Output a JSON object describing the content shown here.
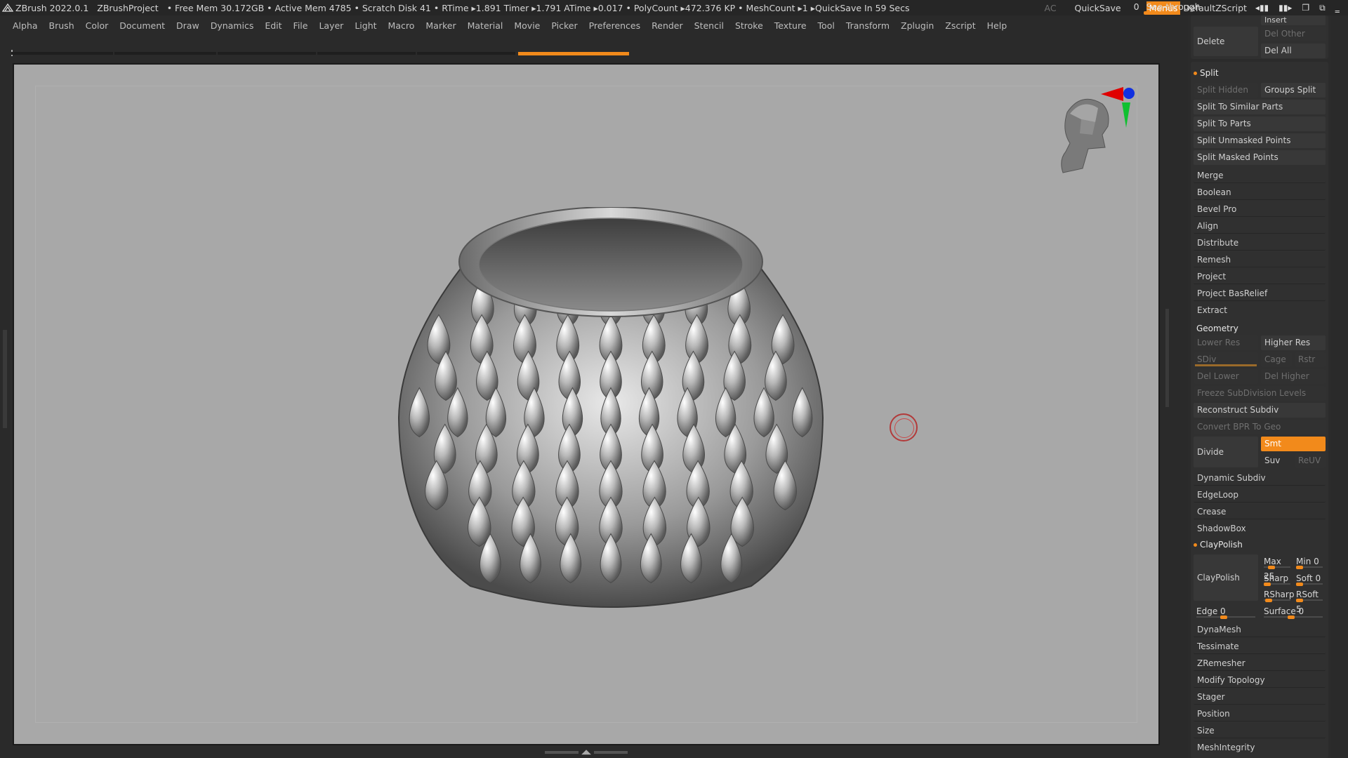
{
  "titlebar": {
    "app": "ZBrush 2022.0.1",
    "project": "ZBrushProject",
    "status": "• Free Mem 30.172GB • Active Mem 4785 • Scratch Disk 41 •  RTime ▸1.891 Timer ▸1.791 ATime ▸0.017 • PolyCount ▸472.376 KP  • MeshCount ▸1  ▸QuickSave In 59 Secs",
    "ac": "AC",
    "quicksave": "QuickSave",
    "seethrough_label": "See-through",
    "seethrough_value": "0",
    "menus": "Menus",
    "default_zscript": "DefaultZScript"
  },
  "menubar": [
    "Alpha",
    "Brush",
    "Color",
    "Document",
    "Draw",
    "Dynamics",
    "Edit",
    "File",
    "Layer",
    "Light",
    "Macro",
    "Marker",
    "Material",
    "Movie",
    "Picker",
    "Preferences",
    "Render",
    "Stencil",
    "Stroke",
    "Texture",
    "Tool",
    "Transform",
    "Zplugin",
    "Zscript",
    "Help"
  ],
  "panel": {
    "insert": "Insert",
    "delete": "Delete",
    "del_other": "Del Other",
    "del_all": "Del All",
    "split_title": "Split",
    "split_hidden": "Split Hidden",
    "groups_split": "Groups Split",
    "split_similar": "Split To Similar Parts",
    "split_parts": "Split To Parts",
    "split_unmasked": "Split Unmasked Points",
    "split_masked": "Split Masked Points",
    "merge": "Merge",
    "boolean": "Boolean",
    "bevel_pro": "Bevel Pro",
    "align": "Align",
    "distribute": "Distribute",
    "remesh": "Remesh",
    "project": "Project",
    "project_basrelief": "Project BasRelief",
    "extract": "Extract",
    "geometry_title": "Geometry",
    "lower_res": "Lower Res",
    "higher_res": "Higher Res",
    "sdiv": "SDiv",
    "cage": "Cage",
    "rstr": "Rstr",
    "del_lower": "Del Lower",
    "del_higher": "Del Higher",
    "freeze_subdiv": "Freeze SubDivision Levels",
    "reconstruct_subdiv": "Reconstruct Subdiv",
    "convert_bpr": "Convert BPR To Geo",
    "divide": "Divide",
    "smt": "Smt",
    "suv": "Suv",
    "reuv": "ReUV",
    "dynamic_subdiv": "Dynamic Subdiv",
    "edgeloop": "EdgeLoop",
    "crease": "Crease",
    "shadowbox": "ShadowBox",
    "claypolish_title": "ClayPolish",
    "claypolish": "ClayPolish",
    "max": "Max 25",
    "min": "Min 0",
    "sharp": "Sharp",
    "soft": "Soft 0",
    "rsharp": "RSharp",
    "rsoft": "RSoft 5",
    "edge": "Edge 0",
    "surface": "Surface 0",
    "dynamesh": "DynaMesh",
    "tessimate": "Tessimate",
    "zremesher": "ZRemesher",
    "modify_topology": "Modify Topology",
    "stager": "Stager",
    "position": "Position",
    "size": "Size",
    "meshintegrity": "MeshIntegrity"
  },
  "colors": {
    "accent": "#f28a1b",
    "viewport": "#a8a8a8",
    "panel": "#2b2b2b"
  }
}
